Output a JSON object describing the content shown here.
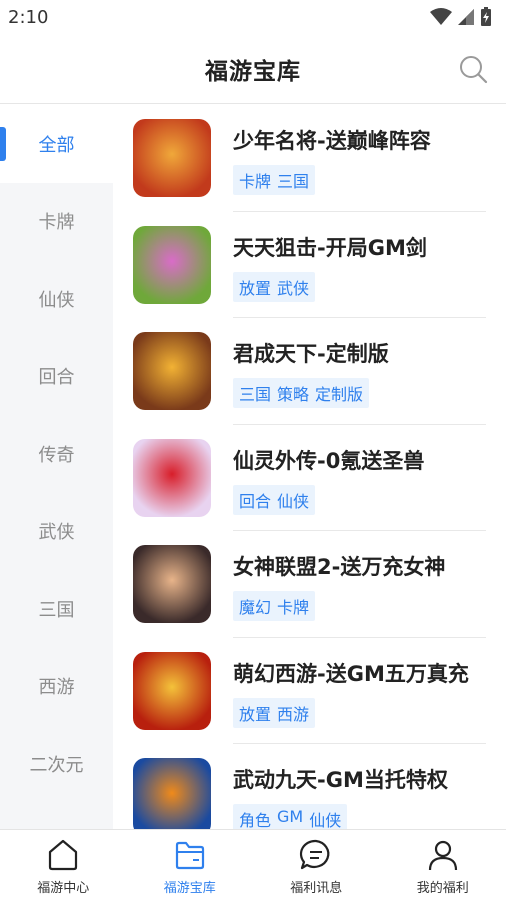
{
  "status": {
    "time": "2:10"
  },
  "header": {
    "title": "福游宝库"
  },
  "sidebar": {
    "items": [
      {
        "label": "全部",
        "active": true
      },
      {
        "label": "卡牌"
      },
      {
        "label": "仙侠"
      },
      {
        "label": "回合"
      },
      {
        "label": "传奇"
      },
      {
        "label": "武侠"
      },
      {
        "label": "三国"
      },
      {
        "label": "西游"
      },
      {
        "label": "二次元"
      }
    ]
  },
  "games": [
    {
      "name": "少年名将-送巅峰阵容",
      "tags": [
        "卡牌",
        "三国"
      ],
      "icon_colors": [
        "#c23a1c",
        "#f0a83a"
      ]
    },
    {
      "name": "天天狙击-开局GM剑",
      "tags": [
        "放置",
        "武侠"
      ],
      "icon_colors": [
        "#6fa83a",
        "#d96cc8"
      ]
    },
    {
      "name": "君成天下-定制版",
      "tags": [
        "三国",
        "策略",
        "定制版"
      ],
      "icon_colors": [
        "#7a3a1a",
        "#f2b234"
      ]
    },
    {
      "name": "仙灵外传-0氪送圣兽",
      "tags": [
        "回合",
        "仙侠"
      ],
      "icon_colors": [
        "#e8d3f0",
        "#d81e2a"
      ]
    },
    {
      "name": "女神联盟2-送万充女神",
      "tags": [
        "魔幻",
        "卡牌"
      ],
      "icon_colors": [
        "#3a2a2a",
        "#e8b48a"
      ]
    },
    {
      "name": "萌幻西游-送GM五万真充",
      "tags": [
        "放置",
        "西游"
      ],
      "icon_colors": [
        "#b8200e",
        "#f4c23a"
      ]
    },
    {
      "name": "武动九天-GM当托特权",
      "tags": [
        "角色",
        "GM",
        "仙侠"
      ],
      "icon_colors": [
        "#1a4aa0",
        "#f08a1a"
      ]
    }
  ],
  "bottom_nav": [
    {
      "label": "福游中心",
      "icon": "home-icon"
    },
    {
      "label": "福游宝库",
      "icon": "folder-icon",
      "active": true
    },
    {
      "label": "福利讯息",
      "icon": "message-icon"
    },
    {
      "label": "我的福利",
      "icon": "user-icon"
    }
  ],
  "colors": {
    "accent": "#2f80ed",
    "sidebar_bg": "#f5f6f8",
    "tag_bg": "#eaf3fd"
  }
}
